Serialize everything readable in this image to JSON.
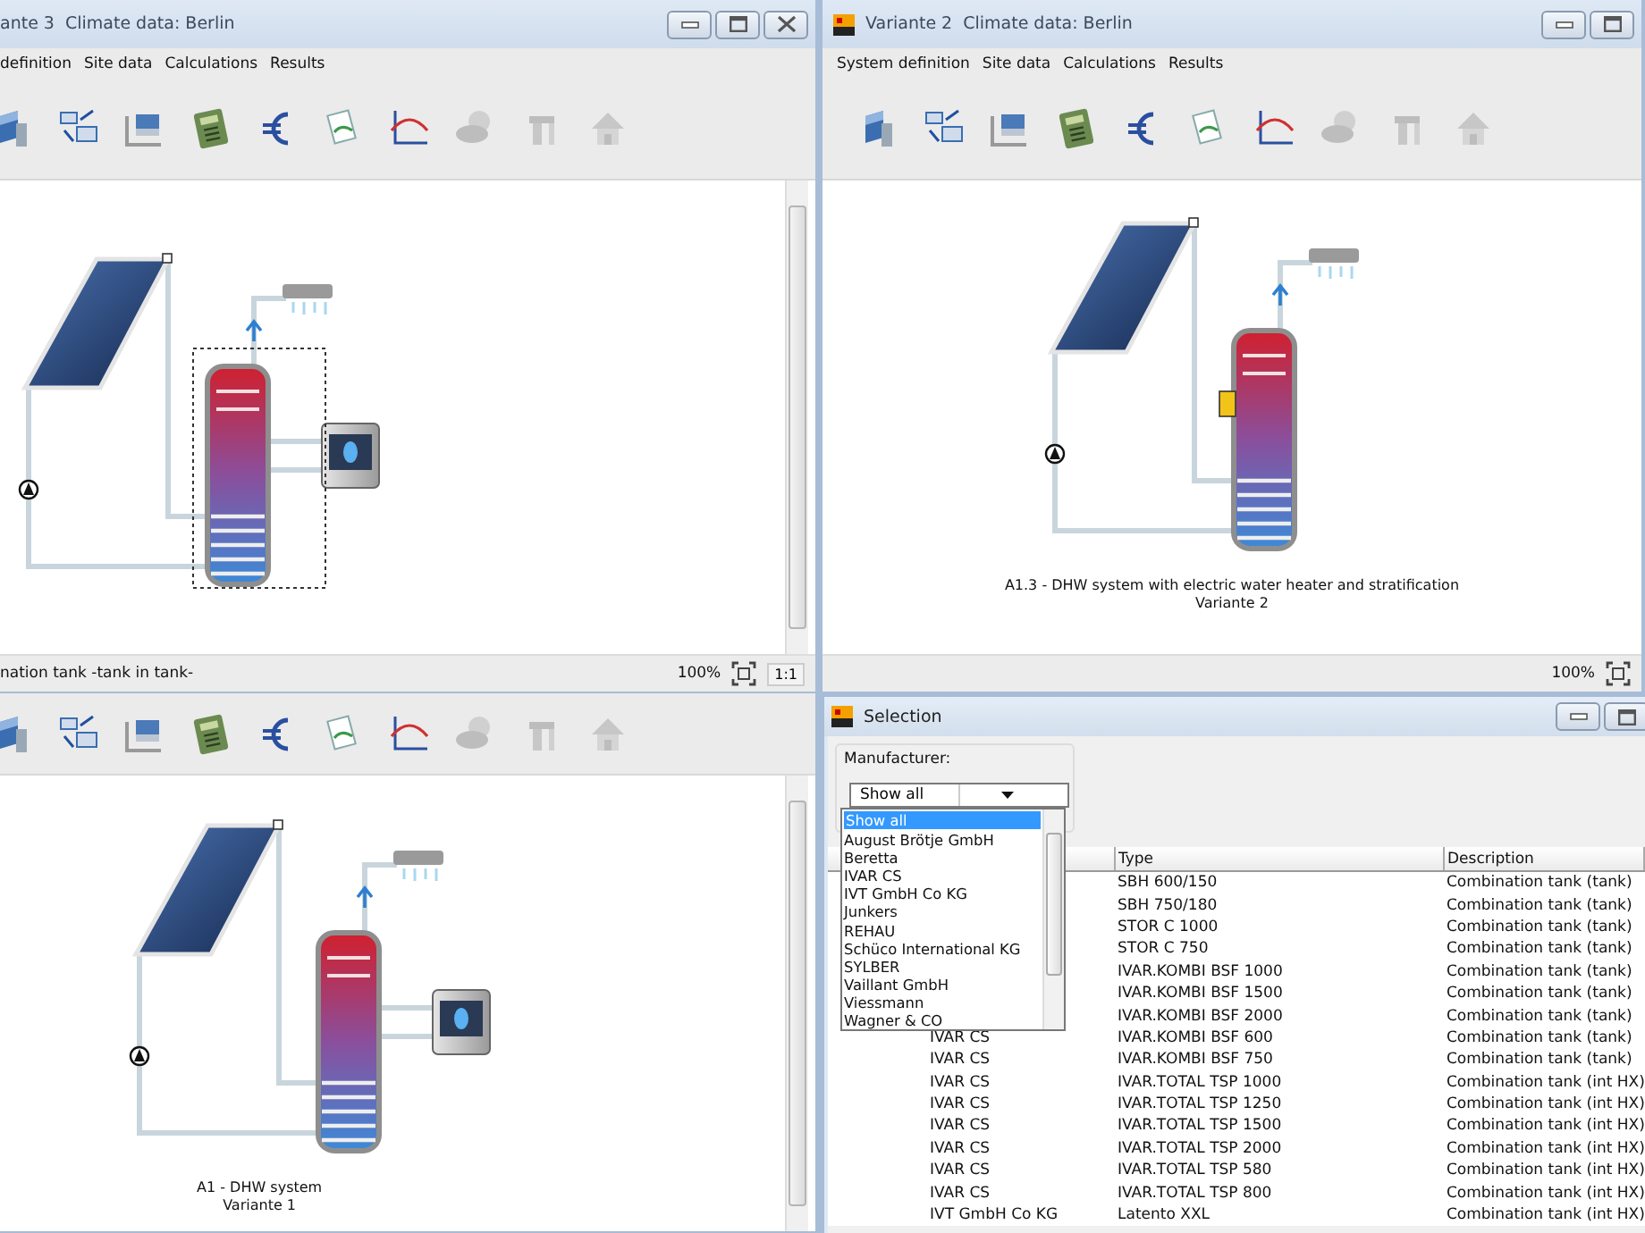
{
  "windows": [
    {
      "kind": "clipped",
      "title_bar": {
        "title": "ante 3",
        "subtitle": "Climate data: Berlin",
        "buttons": [
          {
            "kind": "minimize"
          },
          {
            "kind": "maximize"
          },
          {
            "kind": "close"
          }
        ]
      },
      "menu": [
        "definition",
        "Site data",
        "Calculations",
        "Results"
      ],
      "tools": [
        {
          "kind": "collector",
          "disabled": false
        },
        {
          "kind": "layout",
          "disabled": false
        },
        {
          "kind": "export",
          "disabled": false
        },
        {
          "kind": "calculator",
          "disabled": false
        },
        {
          "kind": "euro",
          "disabled": false
        },
        {
          "kind": "report",
          "disabled": false
        },
        {
          "kind": "chart",
          "disabled": false
        },
        {
          "kind": "weather",
          "disabled": true
        },
        {
          "kind": "crane",
          "disabled": true
        },
        {
          "kind": "house",
          "disabled": true
        }
      ],
      "diagram": {
        "boiler": true,
        "selected": true
      },
      "status_bar": {
        "text": "nation tank -tank in tank-",
        "zoom": "100%",
        "actual_size": "1:1"
      }
    },
    {
      "kind": "framed",
      "title_bar": {
        "app_icon": true,
        "title": "Variante 2",
        "subtitle": "Climate data: Berlin",
        "buttons": [
          {
            "kind": "minimize"
          },
          {
            "kind": "maximize"
          }
        ]
      },
      "menu": [
        "System definition",
        "Site data",
        "Calculations",
        "Results"
      ],
      "tools": [
        {
          "kind": "collector",
          "disabled": false
        },
        {
          "kind": "layout",
          "disabled": false
        },
        {
          "kind": "export",
          "disabled": false
        },
        {
          "kind": "calculator",
          "disabled": false
        },
        {
          "kind": "euro",
          "disabled": false
        },
        {
          "kind": "report",
          "disabled": false
        },
        {
          "kind": "chart",
          "disabled": false
        },
        {
          "kind": "weather",
          "disabled": true
        },
        {
          "kind": "crane",
          "disabled": true
        },
        {
          "kind": "house",
          "disabled": true
        }
      ],
      "diagram": {
        "electric_heater": true,
        "caption": [
          "A1.3 - DHW system with electric water heater and stratification",
          "Variante 2"
        ]
      },
      "status_bar": {
        "zoom": "100%"
      }
    },
    {
      "kind": "clipped",
      "tools": [
        {
          "kind": "collector",
          "disabled": false
        },
        {
          "kind": "layout",
          "disabled": false
        },
        {
          "kind": "export",
          "disabled": false
        },
        {
          "kind": "calculator",
          "disabled": false
        },
        {
          "kind": "euro",
          "disabled": false
        },
        {
          "kind": "report",
          "disabled": false
        },
        {
          "kind": "chart",
          "disabled": false
        },
        {
          "kind": "weather",
          "disabled": true
        },
        {
          "kind": "crane",
          "disabled": true
        },
        {
          "kind": "house",
          "disabled": true
        }
      ],
      "diagram": {
        "boiler": true,
        "caption": [
          "A1 - DHW system",
          "Variante 1"
        ]
      }
    }
  ],
  "selection": {
    "title": "Selection",
    "buttons": [
      {
        "kind": "minimize"
      },
      {
        "kind": "maximize"
      }
    ],
    "manufacturer_label": "Manufacturer:",
    "manufacturer_value": "Show all",
    "dropdown": [
      {
        "label": "Show all",
        "selected": true
      },
      {
        "label": "August Brötje GmbH",
        "selected": false
      },
      {
        "label": "Beretta",
        "selected": false
      },
      {
        "label": "IVAR CS",
        "selected": false
      },
      {
        "label": "IVT GmbH Co KG",
        "selected": false
      },
      {
        "label": "Junkers",
        "selected": false
      },
      {
        "label": "REHAU",
        "selected": false
      },
      {
        "label": "Schüco International KG",
        "selected": false
      },
      {
        "label": "SYLBER",
        "selected": false
      },
      {
        "label": "Vaillant GmbH",
        "selected": false
      },
      {
        "label": "Viessmann",
        "selected": false
      },
      {
        "label": "Wagner & CO",
        "selected": false
      }
    ],
    "table": {
      "columns": [
        "Type",
        "Description"
      ],
      "rows": [
        {
          "type": "SBH 600/150",
          "description": "Combination tank (tank)"
        },
        {
          "type": "SBH 750/180",
          "description": "Combination tank (tank)"
        },
        {
          "type": "STOR C 1000",
          "description": "Combination tank (tank)"
        },
        {
          "type": "STOR C 750",
          "description": "Combination tank (tank)"
        },
        {
          "type": "IVAR.KOMBI BSF 1000",
          "description": "Combination tank (tank)"
        },
        {
          "type": "IVAR.KOMBI BSF 1500",
          "description": "Combination tank (tank)"
        },
        {
          "type": "IVAR.KOMBI BSF 2000",
          "description": "Combination tank (tank)"
        },
        {
          "manufacturer": "IVAR CS",
          "type": "IVAR.KOMBI BSF 600",
          "description": "Combination tank (tank)"
        },
        {
          "manufacturer": "IVAR CS",
          "type": "IVAR.KOMBI BSF 750",
          "description": "Combination tank (tank)"
        },
        {
          "manufacturer": "IVAR CS",
          "type": "IVAR.TOTAL TSP 1000",
          "description": "Combination tank (int HX)"
        },
        {
          "manufacturer": "IVAR CS",
          "type": "IVAR.TOTAL TSP 1250",
          "description": "Combination tank (int HX)"
        },
        {
          "manufacturer": "IVAR CS",
          "type": "IVAR.TOTAL TSP 1500",
          "description": "Combination tank (int HX)"
        },
        {
          "manufacturer": "IVAR CS",
          "type": "IVAR.TOTAL TSP 2000",
          "description": "Combination tank (int HX)"
        },
        {
          "manufacturer": "IVAR CS",
          "type": "IVAR.TOTAL TSP 580",
          "description": "Combination tank (int HX)"
        },
        {
          "manufacturer": "IVAR CS",
          "type": "IVAR.TOTAL TSP 800",
          "description": "Combination tank (int HX)"
        },
        {
          "manufacturer": "IVT GmbH Co KG",
          "type": "Latento XXL",
          "description": "Combination tank (int HX)"
        }
      ]
    }
  }
}
